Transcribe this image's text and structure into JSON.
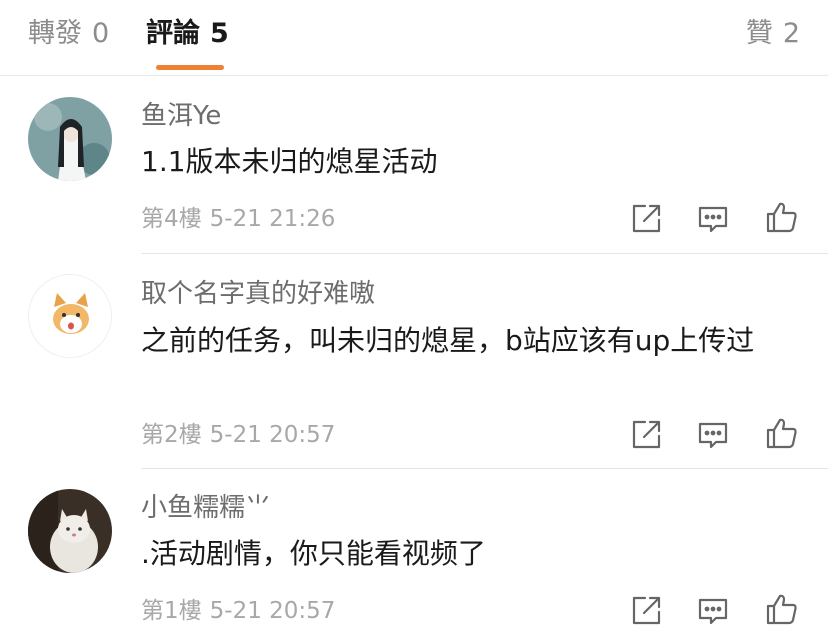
{
  "tabs": {
    "reposts": {
      "label": "轉發",
      "count": "0"
    },
    "comments": {
      "label": "評論",
      "count": "5"
    },
    "likes": {
      "label": "贊",
      "count": "2"
    }
  },
  "accent_color": "#ee8133",
  "comments": [
    {
      "username": "鱼洱Ye",
      "text": "1.1版本未归的熄星活动",
      "floor": "第4樓",
      "time": "5-21 21:26",
      "actions": [
        "repost-icon",
        "comment-icon",
        "like-icon"
      ]
    },
    {
      "username": "取个名字真的好难嗷",
      "text": "之前的任务，叫未归的熄星，b站应该有up上传过",
      "floor": "第2樓",
      "time": "5-21 20:57",
      "actions": [
        "repost-icon",
        "comment-icon",
        "like-icon"
      ]
    },
    {
      "username": "小鱼糯糯⺌",
      "text": ".活动剧情，你只能看视频了",
      "floor": "第1樓",
      "time": "5-21 20:57",
      "actions": [
        "repost-icon",
        "comment-icon",
        "like-icon"
      ]
    }
  ]
}
